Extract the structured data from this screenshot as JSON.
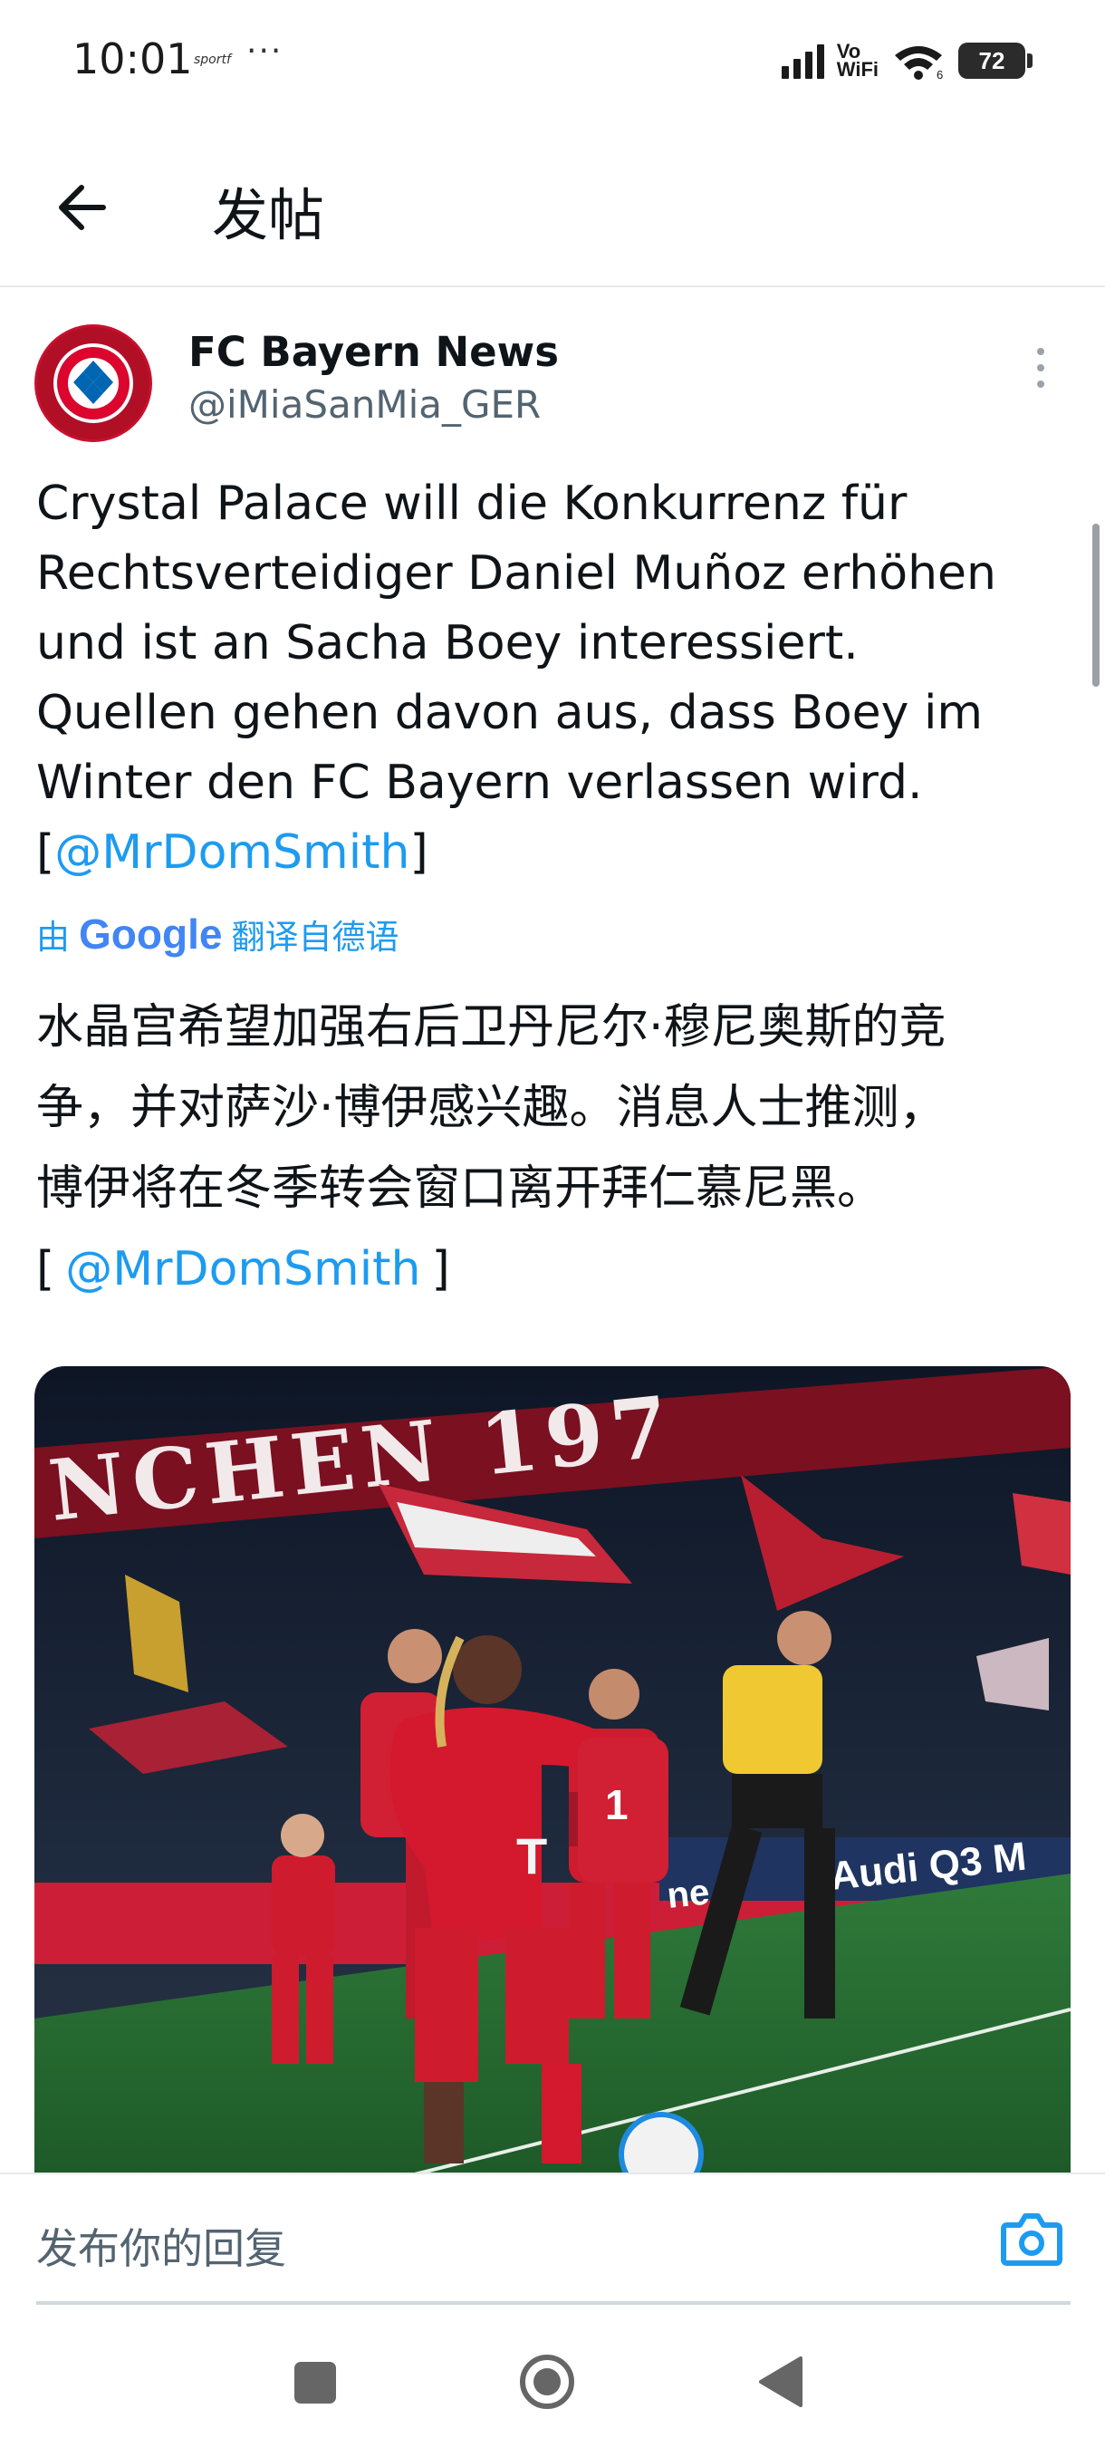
{
  "status_bar": {
    "time": "10:01",
    "notification_label": "sportf",
    "more_dots": "···",
    "vowifi_line1": "Vo",
    "vowifi_line2": "WiFi",
    "wifi_badge": "6",
    "battery": "72"
  },
  "header": {
    "back_icon": "arrow-left-icon",
    "title": "发帖"
  },
  "post": {
    "author": {
      "name": "FC Bayern News",
      "handle": "@iMiaSanMia_GER",
      "avatar_icon": "fc-bayern-logo"
    },
    "more_icon": "more-vertical-icon",
    "text_lines": [
      "Crystal Palace will die Konkurrenz für",
      "Rechtsverteidiger Daniel Muñoz erhöhen",
      "und ist an Sacha Boey interessiert.",
      "Quellen gehen davon aus, dass Boey im",
      "Winter den FC Bayern verlassen wird."
    ],
    "bracket_open": "[",
    "mention": "@MrDomSmith",
    "bracket_close": "]",
    "translated_prefix": "由",
    "translation_provider": "Google",
    "translated_suffix": "翻译自德语",
    "translation_lines": [
      "水晶宫希望加强右后卫丹尼尔·穆尼奥斯的竞",
      "争，并对萨沙·博伊感兴趣。消息人士推测，",
      "博伊将在冬季转会窗口离开拜仁慕尼黑。"
    ],
    "translation_bracket_open": "[",
    "translation_mention": "@MrDomSmith",
    "translation_bracket_close": "]",
    "media": {
      "banner_text": "NCHEN 197",
      "ad_text": "Audi Q3 M",
      "ad_text_2": "ne",
      "shirt_mark": "T",
      "shirt_number": "1"
    }
  },
  "reply": {
    "placeholder": "发布你的回复",
    "camera_icon": "camera-icon"
  },
  "nav": {
    "recents_icon": "square-icon",
    "home_icon": "circle-home-icon",
    "back_icon": "triangle-back-icon"
  },
  "colors": {
    "accent": "#1d9bf0",
    "text": "#0f1419",
    "secondary": "#536471",
    "bayern_red": "#c8102e"
  }
}
